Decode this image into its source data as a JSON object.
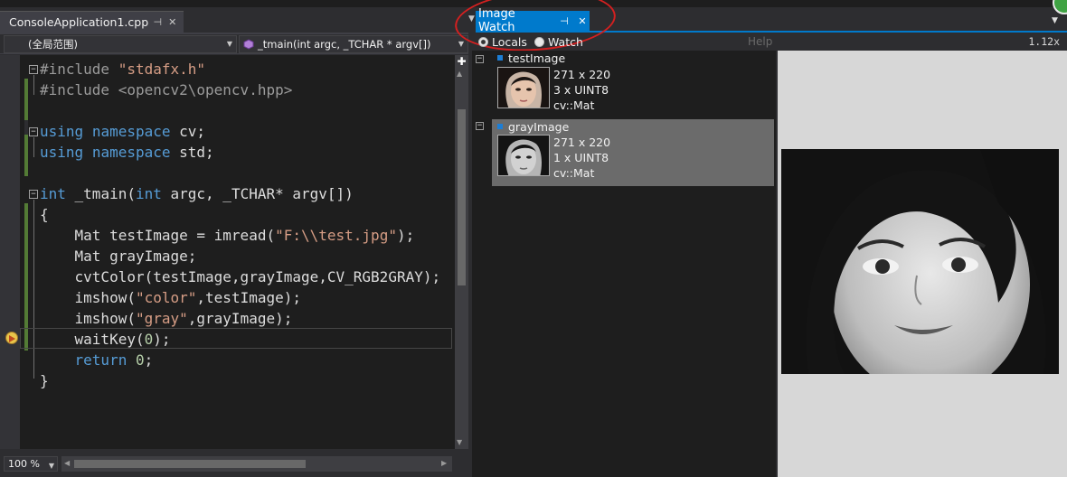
{
  "editor": {
    "tab_title": "ConsoleApplication1.cpp",
    "tab_pin": "⊣",
    "tab_close": "✕",
    "scope_dropdown": "(全局范围)",
    "function_dropdown": "_tmain(int argc, _TCHAR * argv[])",
    "zoom": "100 %",
    "code": {
      "l1_pp": "#include ",
      "l1_str": "\"stdafx.h\"",
      "l2_pp": "#include <opencv2\\opencv.hpp>",
      "l4_kw1": "using",
      "l4_kw2": "namespace",
      "l4_rest": " cv;",
      "l5_kw1": "using",
      "l5_kw2": "namespace",
      "l5_rest": " std;",
      "l7_kw1": "int",
      "l7_a": " _tmain(",
      "l7_kw2": "int",
      "l7_b": " argc, _TCHAR* argv[])",
      "l8": "{",
      "l9_a": "    Mat testImage = imread(",
      "l9_str": "\"F:\\\\test.jpg\"",
      "l9_b": ");",
      "l10": "    Mat grayImage;",
      "l11": "    cvtColor(testImage,grayImage,CV_RGB2GRAY);",
      "l12_a": "    imshow(",
      "l12_str": "\"color\"",
      "l12_b": ",testImage);",
      "l13_a": "    imshow(",
      "l13_str": "\"gray\"",
      "l13_b": ",grayImage);",
      "l14_a": "    waitKey(",
      "l14_num": "0",
      "l14_b": ");",
      "l15_kw": "    return",
      "l15_num": " 0",
      "l15_b": ";",
      "l16": "}"
    }
  },
  "image_watch": {
    "tab_title": "Image Watch",
    "tab_pin": "⊣",
    "tab_close": "✕",
    "radio_locals": "Locals",
    "radio_watch": "Watch",
    "help": "Help",
    "zoom": "1.12x",
    "items": [
      {
        "name": "testImage",
        "dims": "271 x 220",
        "channels": "3 x UINT8",
        "type": "cv::Mat",
        "expander": "−"
      },
      {
        "name": "grayImage",
        "dims": "271 x 220",
        "channels": "1 x UINT8",
        "type": "cv::Mat",
        "expander": "−"
      }
    ]
  },
  "colors": {
    "accent": "#007acc",
    "annotation": "#d42020",
    "selection": "#6b6b6b"
  }
}
